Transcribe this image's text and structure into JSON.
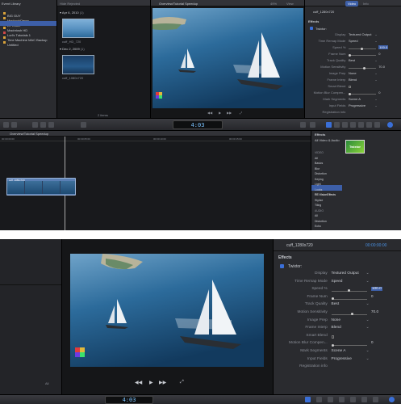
{
  "top": {
    "library": {
      "title": "Event Library",
      "items": [
        {
          "label": "BIG GUY",
          "selected": false
        },
        {
          "label": "MacbookDemo",
          "selected": false
        },
        {
          "label": "LV Room",
          "selected": false
        },
        {
          "label": "Macintosh HD",
          "selected": true
        },
        {
          "label": "Lori's Tutorials 1",
          "selected": false
        },
        {
          "label": "Time Machine MAC Backup",
          "selected": false
        },
        {
          "label": "Untitled",
          "selected": false
        }
      ]
    },
    "browser": {
      "filter": "Hide Rejected",
      "groups": [
        {
          "date": "Apr 6, 2010",
          "count": "(1)",
          "clip": "cuff_HD_720"
        },
        {
          "date": "Dec 2, 2009",
          "count": "(1)",
          "clip": "cuff_1080x720"
        }
      ],
      "footer": "2 items"
    },
    "viewer": {
      "title": "Overview/Tutorial Speedup",
      "zoom": "49%",
      "view_menu": "View"
    },
    "inspector": {
      "tabs": [
        "Video",
        "Info"
      ],
      "clip_name": "cuff_1280x720",
      "section": "Effects",
      "effect_name": "Twixtor:",
      "params": [
        {
          "label": "Display",
          "value": "Textured Output"
        },
        {
          "label": "Time Remap Mode",
          "value": "Speed"
        },
        {
          "label": "Speed %",
          "value": "100.0"
        },
        {
          "label": "Frame Num",
          "value": "0"
        },
        {
          "label": "Track Quality",
          "value": "Best"
        },
        {
          "label": "Motion Sensitivity",
          "value": "70.0"
        },
        {
          "label": "Image Prep",
          "value": "None"
        },
        {
          "label": "Frame Interp",
          "value": "Blend"
        },
        {
          "label": "Smart Blend",
          "value": ""
        },
        {
          "label": "Motion Blur Compen...",
          "value": "0"
        },
        {
          "label": "Mark Segments",
          "value": "Scene A"
        },
        {
          "label": "Input Fields",
          "value": "Progressive"
        },
        {
          "label": "Registration info",
          "value": ""
        }
      ]
    },
    "toolbar": {
      "timecode": "4:03"
    },
    "timeline": {
      "project": "Overview/Tutorial Speedup",
      "ruler": [
        "00:00:00:00",
        "00:00:05:00",
        "00:00:10:00",
        "00:00:15:00"
      ],
      "clip_label": "cuff_1080x720"
    },
    "effects_browser": {
      "title": "Effects",
      "category_header": "All Video & Audio",
      "categories": [
        "VIDEO",
        "All",
        "Basics",
        "Blur",
        "Distortion",
        "Keying",
        "Light",
        "Looks",
        "RE:VisionEffects",
        "Stylize",
        "Tiling",
        "AUDIO",
        "All",
        "Distortion",
        "Echo",
        "EQ"
      ],
      "selected_index": 8,
      "effect_thumb_label": "Twixtor"
    }
  },
  "bottom": {
    "inspector": {
      "clip_name": "cuff_1280x720",
      "timecode": "00:00:00:00",
      "section": "Effects",
      "effect_name": "Twixtor:",
      "params": [
        {
          "label": "Display",
          "value": "Textured Output"
        },
        {
          "label": "Time Remap Mode",
          "value": "Speed"
        },
        {
          "label": "Speed %",
          "value": "100.0"
        },
        {
          "label": "Frame Num",
          "value": "0"
        },
        {
          "label": "Track Quality",
          "value": "Best"
        },
        {
          "label": "Motion Sensitivity",
          "value": "70.0"
        },
        {
          "label": "Image Prep",
          "value": "None"
        },
        {
          "label": "Frame Interp",
          "value": "Blend"
        },
        {
          "label": "Smart Blend",
          "value": ""
        },
        {
          "label": "Motion Blur Compen...",
          "value": "0"
        },
        {
          "label": "Mark Segments",
          "value": "Scene A"
        },
        {
          "label": "Input Fields",
          "value": "Progressive"
        },
        {
          "label": "Registration info",
          "value": ""
        }
      ]
    },
    "browser_footer": "All",
    "toolbar": {
      "timecode": "4:03"
    }
  },
  "colors": {
    "accent": "#3a6fd8",
    "panel": "#2a2b2f",
    "background": "#1e1f22"
  }
}
